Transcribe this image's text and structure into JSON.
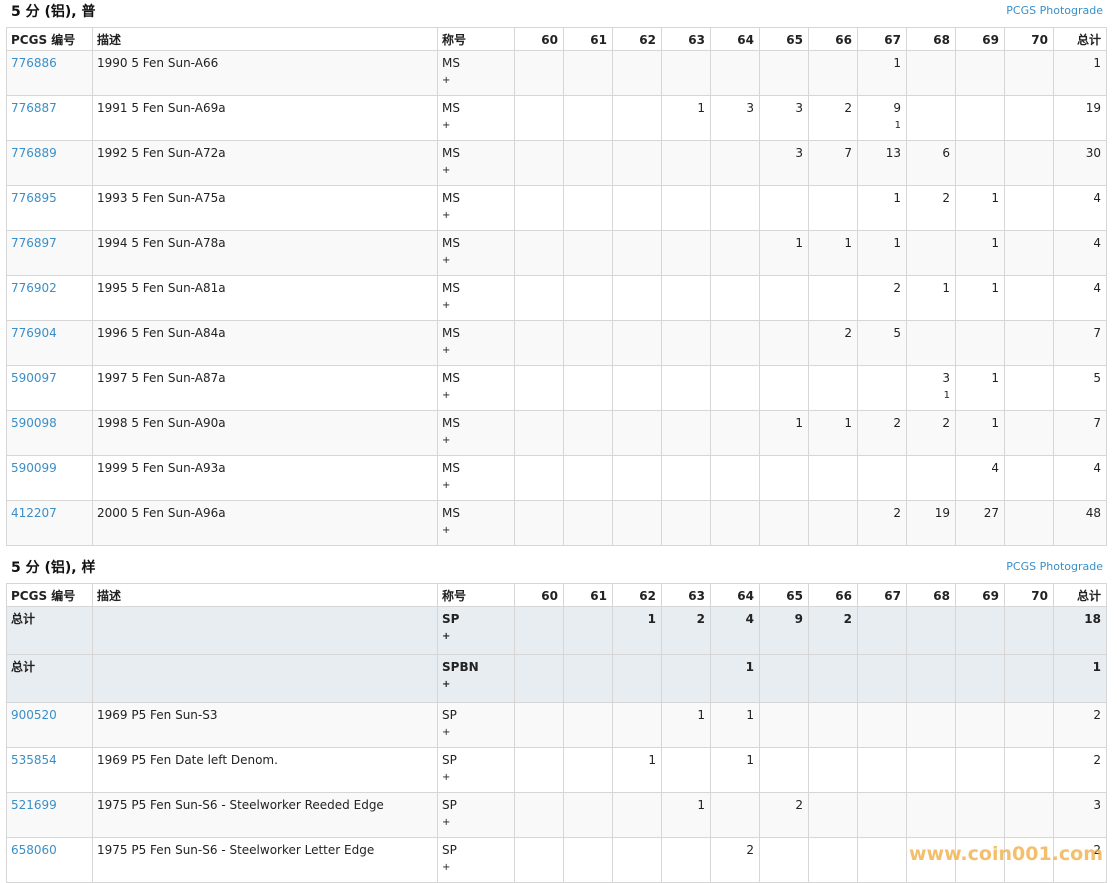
{
  "grades": [
    "60",
    "61",
    "62",
    "63",
    "64",
    "65",
    "66",
    "67",
    "68",
    "69",
    "70"
  ],
  "headers": {
    "code": "PCGS 编号",
    "desc": "描述",
    "designation": "称号",
    "total": "总计"
  },
  "photograde_label": "PCGS Photograde",
  "sections": [
    {
      "title": "5 分 (铝), 普",
      "rows": [
        {
          "code": "776886",
          "desc": "1990 5 Fen Sun-A66",
          "des": "MS",
          "plus": "+",
          "g": [
            "",
            "",
            "",
            "",
            "",
            "",
            "",
            "1",
            "",
            "",
            ""
          ],
          "g2": [
            "",
            "",
            "",
            "",
            "",
            "",
            "",
            "",
            "",
            "",
            ""
          ],
          "total": "1"
        },
        {
          "code": "776887",
          "desc": "1991 5 Fen Sun-A69a",
          "des": "MS",
          "plus": "+",
          "g": [
            "",
            "",
            "",
            "1",
            "3",
            "3",
            "2",
            "9",
            "",
            "",
            ""
          ],
          "g2": [
            "",
            "",
            "",
            "",
            "",
            "",
            "",
            "1",
            "",
            "",
            ""
          ],
          "total": "19"
        },
        {
          "code": "776889",
          "desc": "1992 5 Fen Sun-A72a",
          "des": "MS",
          "plus": "+",
          "g": [
            "",
            "",
            "",
            "",
            "",
            "3",
            "7",
            "13",
            "6",
            "",
            ""
          ],
          "g2": [
            "",
            "",
            "",
            "",
            "",
            "",
            "",
            "",
            "",
            "",
            ""
          ],
          "total": "30"
        },
        {
          "code": "776895",
          "desc": "1993 5 Fen Sun-A75a",
          "des": "MS",
          "plus": "+",
          "g": [
            "",
            "",
            "",
            "",
            "",
            "",
            "",
            "1",
            "2",
            "1",
            ""
          ],
          "g2": [
            "",
            "",
            "",
            "",
            "",
            "",
            "",
            "",
            "",
            "",
            ""
          ],
          "total": "4"
        },
        {
          "code": "776897",
          "desc": "1994 5 Fen Sun-A78a",
          "des": "MS",
          "plus": "+",
          "g": [
            "",
            "",
            "",
            "",
            "",
            "1",
            "1",
            "1",
            "",
            "1",
            ""
          ],
          "g2": [
            "",
            "",
            "",
            "",
            "",
            "",
            "",
            "",
            "",
            "",
            ""
          ],
          "total": "4"
        },
        {
          "code": "776902",
          "desc": "1995 5 Fen Sun-A81a",
          "des": "MS",
          "plus": "+",
          "g": [
            "",
            "",
            "",
            "",
            "",
            "",
            "",
            "2",
            "1",
            "1",
            ""
          ],
          "g2": [
            "",
            "",
            "",
            "",
            "",
            "",
            "",
            "",
            "",
            "",
            ""
          ],
          "total": "4"
        },
        {
          "code": "776904",
          "desc": "1996 5 Fen Sun-A84a",
          "des": "MS",
          "plus": "+",
          "g": [
            "",
            "",
            "",
            "",
            "",
            "",
            "2",
            "5",
            "",
            "",
            ""
          ],
          "g2": [
            "",
            "",
            "",
            "",
            "",
            "",
            "",
            "",
            "",
            "",
            ""
          ],
          "total": "7"
        },
        {
          "code": "590097",
          "desc": "1997 5 Fen Sun-A87a",
          "des": "MS",
          "plus": "+",
          "g": [
            "",
            "",
            "",
            "",
            "",
            "",
            "",
            "",
            "3",
            "1",
            ""
          ],
          "g2": [
            "",
            "",
            "",
            "",
            "",
            "",
            "",
            "",
            "1",
            "",
            ""
          ],
          "total": "5"
        },
        {
          "code": "590098",
          "desc": "1998 5 Fen Sun-A90a",
          "des": "MS",
          "plus": "+",
          "g": [
            "",
            "",
            "",
            "",
            "",
            "1",
            "1",
            "2",
            "2",
            "1",
            ""
          ],
          "g2": [
            "",
            "",
            "",
            "",
            "",
            "",
            "",
            "",
            "",
            "",
            ""
          ],
          "total": "7"
        },
        {
          "code": "590099",
          "desc": "1999 5 Fen Sun-A93a",
          "des": "MS",
          "plus": "+",
          "g": [
            "",
            "",
            "",
            "",
            "",
            "",
            "",
            "",
            "",
            "4",
            ""
          ],
          "g2": [
            "",
            "",
            "",
            "",
            "",
            "",
            "",
            "",
            "",
            "",
            ""
          ],
          "total": "4"
        },
        {
          "code": "412207",
          "desc": "2000 5 Fen Sun-A96a",
          "des": "MS",
          "plus": "+",
          "g": [
            "",
            "",
            "",
            "",
            "",
            "",
            "",
            "2",
            "19",
            "27",
            ""
          ],
          "g2": [
            "",
            "",
            "",
            "",
            "",
            "",
            "",
            "",
            "",
            "",
            ""
          ],
          "total": "48"
        }
      ]
    },
    {
      "title": "5 分 (铝), 样",
      "totals": [
        {
          "label": "总计",
          "des": "SP",
          "plus": "+",
          "g": [
            "",
            "",
            "1",
            "2",
            "4",
            "9",
            "2",
            "",
            "",
            "",
            ""
          ],
          "total": "18"
        },
        {
          "label": "总计",
          "des": "SPBN",
          "plus": "+",
          "g": [
            "",
            "",
            "",
            "",
            "1",
            "",
            "",
            "",
            "",
            "",
            ""
          ],
          "total": "1"
        }
      ],
      "rows": [
        {
          "code": "900520",
          "desc": "1969 P5 Fen Sun-S3",
          "des": "SP",
          "plus": "+",
          "g": [
            "",
            "",
            "",
            "1",
            "1",
            "",
            "",
            "",
            "",
            "",
            ""
          ],
          "g2": [
            "",
            "",
            "",
            "",
            "",
            "",
            "",
            "",
            "",
            "",
            ""
          ],
          "total": "2"
        },
        {
          "code": "535854",
          "desc": "1969 P5 Fen Date left Denom.",
          "des": "SP",
          "plus": "+",
          "g": [
            "",
            "",
            "1",
            "",
            "1",
            "",
            "",
            "",
            "",
            "",
            ""
          ],
          "g2": [
            "",
            "",
            "",
            "",
            "",
            "",
            "",
            "",
            "",
            "",
            ""
          ],
          "total": "2"
        },
        {
          "code": "521699",
          "desc": "1975 P5 Fen Sun-S6 - Steelworker Reeded Edge",
          "des": "SP",
          "plus": "+",
          "g": [
            "",
            "",
            "",
            "1",
            "",
            "2",
            "",
            "",
            "",
            "",
            ""
          ],
          "g2": [
            "",
            "",
            "",
            "",
            "",
            "",
            "",
            "",
            "",
            "",
            ""
          ],
          "total": "3"
        },
        {
          "code": "658060",
          "desc": "1975 P5 Fen Sun-S6 - Steelworker Letter Edge",
          "des": "SP",
          "plus": "+",
          "g": [
            "",
            "",
            "",
            "",
            "2",
            "",
            "",
            "",
            "",
            "",
            ""
          ],
          "g2": [
            "",
            "",
            "",
            "",
            "",
            "",
            "",
            "",
            "",
            "",
            ""
          ],
          "total": "2"
        }
      ]
    }
  ],
  "watermark": "www.coin001.com"
}
